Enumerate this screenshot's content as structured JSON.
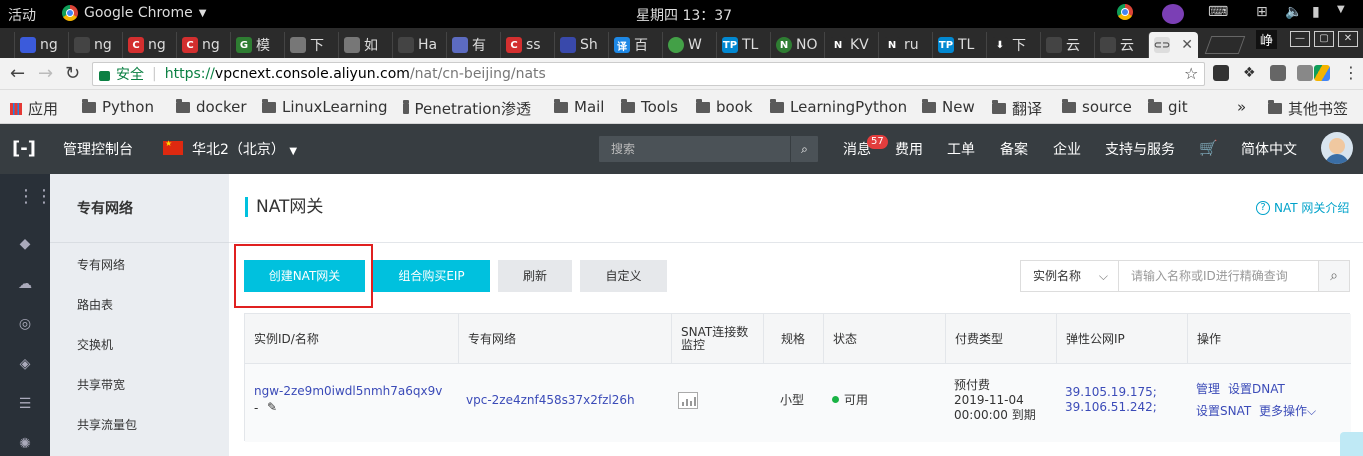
{
  "os": {
    "activities": "活动",
    "app_name": "Google Chrome",
    "clock": "星期四 13：37"
  },
  "tabs": [
    {
      "label": "ng",
      "icon": "tab-favicon"
    },
    {
      "label": "ng",
      "icon": "tab-favicon"
    },
    {
      "label": "ng",
      "icon": "tab-favicon"
    },
    {
      "label": "ng",
      "icon": "tab-favicon"
    },
    {
      "label": "模",
      "icon": "tab-favicon"
    },
    {
      "label": "下",
      "icon": "doc-icon"
    },
    {
      "label": "如",
      "icon": "doc-icon"
    },
    {
      "label": "Ha",
      "icon": "tab-favicon"
    },
    {
      "label": "有",
      "icon": "tab-favicon"
    },
    {
      "label": "ss",
      "icon": "tab-favicon"
    },
    {
      "label": "Sh",
      "icon": "tab-favicon"
    },
    {
      "label": "百",
      "icon": "tab-favicon"
    },
    {
      "label": "W",
      "icon": "wechat-icon"
    },
    {
      "label": "TL",
      "icon": "tab-favicon"
    },
    {
      "label": "NO",
      "icon": "tab-favicon"
    },
    {
      "label": "KV",
      "icon": "tab-favicon"
    },
    {
      "label": "ru",
      "icon": "tab-favicon"
    },
    {
      "label": "TL",
      "icon": "tab-favicon"
    },
    {
      "label": "下",
      "icon": "download-icon"
    },
    {
      "label": "云",
      "icon": "tab-favicon"
    },
    {
      "label": "云",
      "icon": "tab-favicon"
    }
  ],
  "ime": "峥",
  "address": {
    "secure_label": "安全",
    "scheme": "https://",
    "host": "vpcnext.console.aliyun.com",
    "path": "/nat/cn-beijing/nats"
  },
  "bookmarks": {
    "apps": "应用",
    "items": [
      "Python",
      "docker",
      "LinuxLearning",
      "Penetration渗透",
      "Mail",
      "Tools",
      "book",
      "LearningPython",
      "New",
      "翻译",
      "source",
      "git"
    ],
    "more": "»",
    "other": "其他书签"
  },
  "header": {
    "console": "管理控制台",
    "region": "华北2（北京）",
    "search_placeholder": "搜索",
    "messages": "消息",
    "message_count": "57",
    "nav": [
      "费用",
      "工单",
      "备案",
      "企业",
      "支持与服务"
    ],
    "language": "简体中文"
  },
  "sidebar": {
    "title": "专有网络",
    "items": [
      "专有网络",
      "路由表",
      "交换机",
      "共享带宽",
      "共享流量包"
    ]
  },
  "main": {
    "title": "NAT网关",
    "help": "NAT 网关介绍",
    "buttons": {
      "create": "创建NAT网关",
      "combo_eip": "组合购买EIP",
      "refresh": "刷新",
      "customize": "自定义"
    },
    "filter": {
      "field": "实例名称",
      "placeholder": "请输入名称或ID进行精确查询"
    },
    "columns": [
      "实例ID/名称",
      "专有网络",
      "SNAT连接数监控",
      "规格",
      "状态",
      "付费类型",
      "弹性公网IP",
      "操作"
    ],
    "row": {
      "id": "ngw-2ze9m0iwdl5nmh7a6qx9v",
      "name": "-",
      "vpc": "vpc-2ze4znf458s37x2fzl26h",
      "spec": "小型",
      "status": "可用",
      "pay_type": "预付费",
      "expire_date": "2019-11-04",
      "expire_time": "00:00:00 到期",
      "eip1": "39.105.19.175;",
      "eip2": "39.106.51.242;",
      "actions": {
        "manage": "管理",
        "dnat": "设置DNAT",
        "snat": "设置SNAT",
        "more": "更多操作"
      }
    }
  },
  "colors": {
    "accent": "#00c1de",
    "header_bg": "#373d41",
    "link": "#3b4bb8",
    "status_ok": "#1ab345",
    "highlight_box": "#e02020"
  }
}
